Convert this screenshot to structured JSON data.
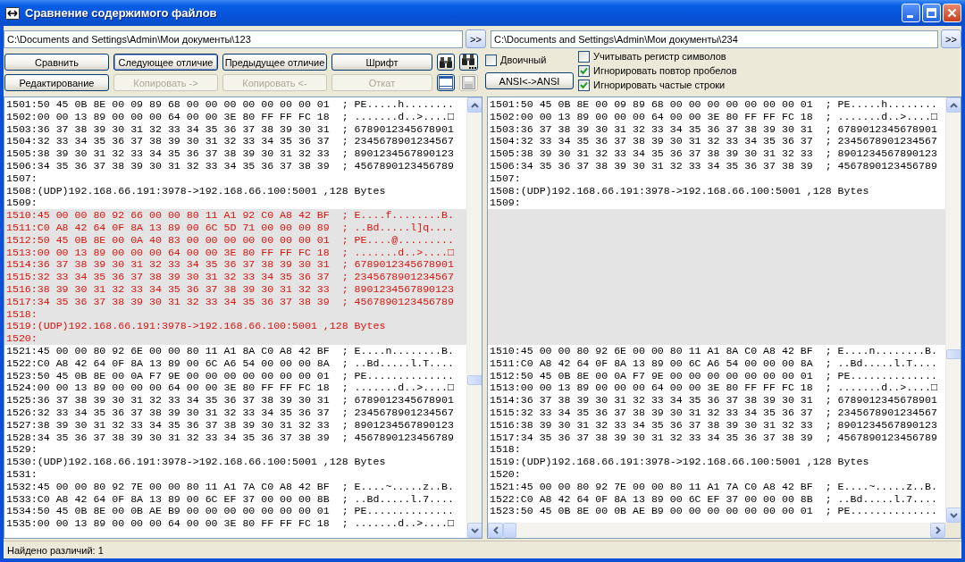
{
  "window": {
    "title": "Сравнение содержимого файлов"
  },
  "paths": [
    {
      "value": "C:\\Documents and Settings\\Admin\\Мои документы\\123",
      "button": ">>"
    },
    {
      "value": "C:\\Documents and Settings\\Admin\\Мои документы\\234",
      "button": ">>"
    }
  ],
  "button_rows": [
    {
      "buttons": [
        {
          "label": "Сравнить",
          "disabled": false,
          "focused": false
        },
        {
          "label": "Следующее отличие",
          "disabled": false,
          "focused": true
        },
        {
          "label": "Предыдущее отличие",
          "disabled": false,
          "focused": false
        },
        {
          "label": "Шрифт",
          "disabled": false,
          "focused": false
        }
      ],
      "icons": [
        {
          "disabled": false
        },
        {
          "disabled": false
        }
      ]
    },
    {
      "buttons": [
        {
          "label": "Редактирование",
          "disabled": false,
          "focused": false
        },
        {
          "label": "Копировать ->",
          "disabled": true,
          "focused": false
        },
        {
          "label": "Копировать <-",
          "disabled": true,
          "focused": false
        },
        {
          "label": "Откат",
          "disabled": true,
          "focused": false
        }
      ],
      "icons": [
        {
          "disabled": false
        },
        {
          "disabled": true
        }
      ]
    }
  ],
  "binary": {
    "label": "Двоичный",
    "checked": false
  },
  "encoding_button": "ANSI<->ANSI",
  "options": [
    {
      "label": "Учитывать регистр символов",
      "checked": false
    },
    {
      "label": "Игнорировать повтор пробелов",
      "checked": true
    },
    {
      "label": "Игнорировать частые строки",
      "checked": true
    }
  ],
  "panes": [
    {
      "lines": [
        {
          "kind": "normal",
          "text": "1501:50 45 0B 8E 00 09 89 68 00 00 00 00 00 00 00 01  ; PE.....h........"
        },
        {
          "kind": "normal",
          "text": "1502:00 00 13 89 00 00 00 64 00 00 3E 80 FF FF FC 18  ; .......d..>....□"
        },
        {
          "kind": "normal",
          "text": "1503:36 37 38 39 30 31 32 33 34 35 36 37 38 39 30 31  ; 6789012345678901"
        },
        {
          "kind": "normal",
          "text": "1504:32 33 34 35 36 37 38 39 30 31 32 33 34 35 36 37  ; 2345678901234567"
        },
        {
          "kind": "normal",
          "text": "1505:38 39 30 31 32 33 34 35 36 37 38 39 30 31 32 33  ; 8901234567890123"
        },
        {
          "kind": "normal",
          "text": "1506:34 35 36 37 38 39 30 31 32 33 34 35 36 37 38 39  ; 4567890123456789"
        },
        {
          "kind": "normal",
          "text": "1507:"
        },
        {
          "kind": "normal",
          "text": "1508:(UDP)192.168.66.191:3978->192.168.66.100:5001 ,128 Bytes"
        },
        {
          "kind": "normal",
          "text": "1509:"
        },
        {
          "kind": "diff",
          "text": "1510:45 00 00 80 92 66 00 00 80 11 A1 92 C0 A8 42 BF  ; E....f........B."
        },
        {
          "kind": "diff",
          "text": "1511:C0 A8 42 64 0F 8A 13 89 00 6C 5D 71 00 00 00 89  ; ..Bd.....l]q...."
        },
        {
          "kind": "diff",
          "text": "1512:50 45 0B 8E 00 0A 40 83 00 00 00 00 00 00 00 01  ; PE....@........."
        },
        {
          "kind": "diff",
          "text": "1513:00 00 13 89 00 00 00 64 00 00 3E 80 FF FF FC 18  ; .......d..>....□"
        },
        {
          "kind": "diff",
          "text": "1514:36 37 38 39 30 31 32 33 34 35 36 37 38 39 30 31  ; 6789012345678901"
        },
        {
          "kind": "diff",
          "text": "1515:32 33 34 35 36 37 38 39 30 31 32 33 34 35 36 37  ; 2345678901234567"
        },
        {
          "kind": "diff",
          "text": "1516:38 39 30 31 32 33 34 35 36 37 38 39 30 31 32 33  ; 8901234567890123"
        },
        {
          "kind": "diff",
          "text": "1517:34 35 36 37 38 39 30 31 32 33 34 35 36 37 38 39  ; 4567890123456789"
        },
        {
          "kind": "diff",
          "text": "1518:"
        },
        {
          "kind": "diff",
          "text": "1519:(UDP)192.168.66.191:3978->192.168.66.100:5001 ,128 Bytes"
        },
        {
          "kind": "diff",
          "text": "1520:"
        },
        {
          "kind": "normal",
          "text": "1521:45 00 00 80 92 6E 00 00 80 11 A1 8A C0 A8 42 BF  ; E....n........B."
        },
        {
          "kind": "normal",
          "text": "1522:C0 A8 42 64 0F 8A 13 89 00 6C A6 54 00 00 00 8A  ; ..Bd.....l.T...."
        },
        {
          "kind": "normal",
          "text": "1523:50 45 0B 8E 00 0A F7 9E 00 00 00 00 00 00 00 01  ; PE.............."
        },
        {
          "kind": "normal",
          "text": "1524:00 00 13 89 00 00 00 64 00 00 3E 80 FF FF FC 18  ; .......d..>....□"
        },
        {
          "kind": "normal",
          "text": "1525:36 37 38 39 30 31 32 33 34 35 36 37 38 39 30 31  ; 6789012345678901"
        },
        {
          "kind": "normal",
          "text": "1526:32 33 34 35 36 37 38 39 30 31 32 33 34 35 36 37  ; 2345678901234567"
        },
        {
          "kind": "normal",
          "text": "1527:38 39 30 31 32 33 34 35 36 37 38 39 30 31 32 33  ; 8901234567890123"
        },
        {
          "kind": "normal",
          "text": "1528:34 35 36 37 38 39 30 31 32 33 34 35 36 37 38 39  ; 4567890123456789"
        },
        {
          "kind": "normal",
          "text": "1529:"
        },
        {
          "kind": "normal",
          "text": "1530:(UDP)192.168.66.191:3978->192.168.66.100:5001 ,128 Bytes"
        },
        {
          "kind": "normal",
          "text": "1531:"
        },
        {
          "kind": "normal",
          "text": "1532:45 00 00 80 92 7E 00 00 80 11 A1 7A C0 A8 42 BF  ; E....~.....z..B."
        },
        {
          "kind": "normal",
          "text": "1533:C0 A8 42 64 0F 8A 13 89 00 6C EF 37 00 00 00 8B  ; ..Bd.....l.7...."
        },
        {
          "kind": "normal",
          "text": "1534:50 45 0B 8E 00 0B AE B9 00 00 00 00 00 00 00 01  ; PE.............."
        },
        {
          "kind": "normal",
          "text": "1535:00 00 13 89 00 00 00 64 00 00 3E 80 FF FF FC 18  ; .......d..>....□"
        }
      ]
    },
    {
      "lines": [
        {
          "kind": "normal",
          "text": "1501:50 45 0B 8E 00 09 89 68 00 00 00 00 00 00 00 01  ; PE.....h........"
        },
        {
          "kind": "normal",
          "text": "1502:00 00 13 89 00 00 00 64 00 00 3E 80 FF FF FC 18  ; .......d..>....□"
        },
        {
          "kind": "normal",
          "text": "1503:36 37 38 39 30 31 32 33 34 35 36 37 38 39 30 31  ; 6789012345678901"
        },
        {
          "kind": "normal",
          "text": "1504:32 33 34 35 36 37 38 39 30 31 32 33 34 35 36 37  ; 2345678901234567"
        },
        {
          "kind": "normal",
          "text": "1505:38 39 30 31 32 33 34 35 36 37 38 39 30 31 32 33  ; 8901234567890123"
        },
        {
          "kind": "normal",
          "text": "1506:34 35 36 37 38 39 30 31 32 33 34 35 36 37 38 39  ; 4567890123456789"
        },
        {
          "kind": "normal",
          "text": "1507:"
        },
        {
          "kind": "normal",
          "text": "1508:(UDP)192.168.66.191:3978->192.168.66.100:5001 ,128 Bytes"
        },
        {
          "kind": "normal",
          "text": "1509:"
        },
        {
          "kind": "gap"
        },
        {
          "kind": "gap"
        },
        {
          "kind": "gap"
        },
        {
          "kind": "gap"
        },
        {
          "kind": "gap"
        },
        {
          "kind": "gap"
        },
        {
          "kind": "gap"
        },
        {
          "kind": "gap"
        },
        {
          "kind": "gap"
        },
        {
          "kind": "gap"
        },
        {
          "kind": "gap"
        },
        {
          "kind": "normal",
          "text": "1510:45 00 00 80 92 6E 00 00 80 11 A1 8A C0 A8 42 BF  ; E....n........B."
        },
        {
          "kind": "normal",
          "text": "1511:C0 A8 42 64 0F 8A 13 89 00 6C A6 54 00 00 00 8A  ; ..Bd.....l.T...."
        },
        {
          "kind": "normal",
          "text": "1512:50 45 0B 8E 00 0A F7 9E 00 00 00 00 00 00 00 01  ; PE.............."
        },
        {
          "kind": "normal",
          "text": "1513:00 00 13 89 00 00 00 64 00 00 3E 80 FF FF FC 18  ; .......d..>....□"
        },
        {
          "kind": "normal",
          "text": "1514:36 37 38 39 30 31 32 33 34 35 36 37 38 39 30 31  ; 6789012345678901"
        },
        {
          "kind": "normal",
          "text": "1515:32 33 34 35 36 37 38 39 30 31 32 33 34 35 36 37  ; 2345678901234567"
        },
        {
          "kind": "normal",
          "text": "1516:38 39 30 31 32 33 34 35 36 37 38 39 30 31 32 33  ; 8901234567890123"
        },
        {
          "kind": "normal",
          "text": "1517:34 35 36 37 38 39 30 31 32 33 34 35 36 37 38 39  ; 4567890123456789"
        },
        {
          "kind": "normal",
          "text": "1518:"
        },
        {
          "kind": "normal",
          "text": "1519:(UDP)192.168.66.191:3978->192.168.66.100:5001 ,128 Bytes"
        },
        {
          "kind": "normal",
          "text": "1520:"
        },
        {
          "kind": "normal",
          "text": "1521:45 00 00 80 92 7E 00 00 80 11 A1 7A C0 A8 42 BF  ; E....~.....z..B."
        },
        {
          "kind": "normal",
          "text": "1522:C0 A8 42 64 0F 8A 13 89 00 6C EF 37 00 00 00 8B  ; ..Bd.....l.7...."
        },
        {
          "kind": "normal",
          "text": "1523:50 45 0B 8E 00 0B AE B9 00 00 00 00 00 00 00 01  ; PE.............."
        }
      ]
    }
  ],
  "status_bar": "Найдено различий: 1"
}
